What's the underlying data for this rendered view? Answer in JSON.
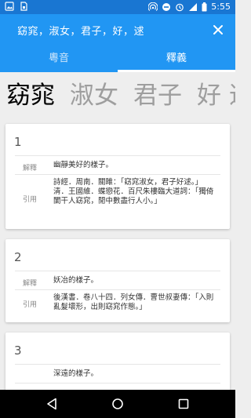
{
  "status_bar": {
    "time": "5:55",
    "icons": [
      "image-notification-icon",
      "sim-card-icon",
      "hotspot-icon",
      "do-not-disturb-icon",
      "alarm-icon",
      "lte-signal-icon",
      "battery-icon"
    ]
  },
  "app_bar": {
    "title": "窈窕，淑女，君子，好，逑",
    "close_icon": "close-icon"
  },
  "tabs": [
    {
      "label": "粵音",
      "active": false
    },
    {
      "label": "釋義",
      "active": true
    }
  ],
  "words": [
    "窈窕",
    "淑女",
    "君子",
    "好",
    "逑"
  ],
  "current_word_index": 0,
  "cards": [
    {
      "number": "1",
      "rows": [
        {
          "label": "解釋",
          "text": "幽靜美好的樣子。"
        },
        {
          "label": "引用",
          "text": "詩經．周南．關雎：「窈窕淑女，君子好逑。」\n清．王國維．蝶戀花．百尺朱樓臨大道詞：「獨倚闌干人窈窕，閒中數盡行人小。」"
        }
      ]
    },
    {
      "number": "2",
      "rows": [
        {
          "label": "解釋",
          "text": "妖冶的樣子。"
        },
        {
          "label": "引用",
          "text": "後漢書．卷八十四．列女傳．曹世叔妻傳：「入則亂髮壞形，出則窈窕作態。」"
        }
      ]
    },
    {
      "number": "3",
      "rows": [
        {
          "label": "",
          "text": "深遠的樣子。"
        }
      ]
    }
  ],
  "nav_bar": {
    "icons": [
      "back-icon",
      "home-icon",
      "recents-icon"
    ]
  },
  "colors": {
    "primary": "#2196f3",
    "primary_dark": "#1976d2",
    "background": "#eeeeee"
  }
}
